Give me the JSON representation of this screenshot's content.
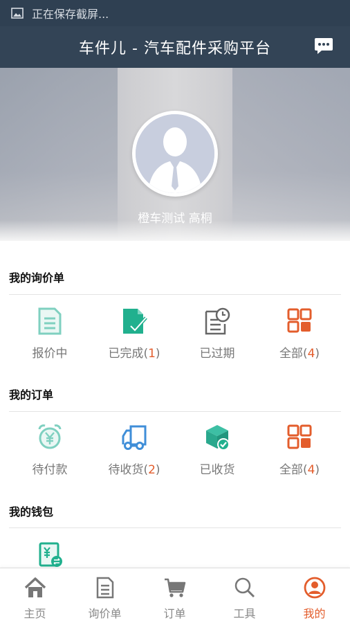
{
  "status_bar": {
    "text": "正在保存截屏..."
  },
  "header": {
    "title": "车件儿 - 汽车配件采购平台"
  },
  "profile": {
    "name": "橙车测试 高桐"
  },
  "inquiries": {
    "title": "我的询价单",
    "items": [
      {
        "label": "报价中",
        "count": ""
      },
      {
        "label": "已完成",
        "count": "1"
      },
      {
        "label": "已过期",
        "count": ""
      },
      {
        "label": "全部",
        "count": "4"
      }
    ]
  },
  "orders": {
    "title": "我的订单",
    "items": [
      {
        "label": "待付款",
        "count": ""
      },
      {
        "label": "待收货",
        "count": "2"
      },
      {
        "label": "已收货",
        "count": ""
      },
      {
        "label": "全部",
        "count": "4"
      }
    ]
  },
  "wallet": {
    "title": "我的钱包"
  },
  "tabbar": {
    "items": [
      {
        "label": "主页"
      },
      {
        "label": "询价单"
      },
      {
        "label": "订单"
      },
      {
        "label": "工具"
      },
      {
        "label": "我的"
      }
    ]
  },
  "colors": {
    "header": "#334456",
    "accent": "#e35d2c",
    "teal": "#3dbfa4",
    "blue": "#3f8ed8"
  }
}
